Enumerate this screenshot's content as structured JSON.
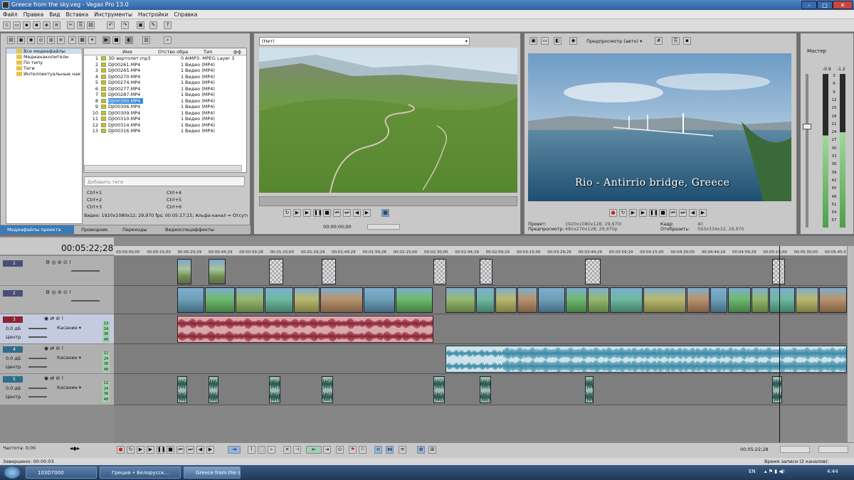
{
  "window": {
    "title": "Greece from the sky.veg - Vegas Pro 13.0"
  },
  "menu": [
    "Файл",
    "Правка",
    "Вид",
    "Вставка",
    "Инструменты",
    "Настройки",
    "Справка"
  ],
  "media_tree": {
    "items": [
      "Все медиафайлы",
      "Медианакопители",
      "По типу",
      "Теги",
      "Интеллектуальные нак"
    ]
  },
  "media_list": {
    "headers": [
      "Имя",
      "Отство обра",
      "Тип",
      "фф"
    ],
    "rows": [
      {
        "num": "1",
        "name": "3D вертолет.mp3",
        "count": "0",
        "type": "AIMP3: MPEG Layer 3"
      },
      {
        "num": "2",
        "name": "DJI00261.MP4",
        "count": "1",
        "type": "Видео (MP4)"
      },
      {
        "num": "3",
        "name": "DJI00265.MP4",
        "count": "1",
        "type": "Видео (MP4)"
      },
      {
        "num": "4",
        "name": "DJI00270.MP4",
        "count": "1",
        "type": "Видео (MP4)"
      },
      {
        "num": "5",
        "name": "DJI00274.MP4",
        "count": "1",
        "type": "Видео (MP4)"
      },
      {
        "num": "6",
        "name": "DJI00277.MP4",
        "count": "1",
        "type": "Видео (MP4)"
      },
      {
        "num": "7",
        "name": "DJI00287.MP4",
        "count": "1",
        "type": "Видео (MP4)"
      },
      {
        "num": "8",
        "name": "DJI00300.MP4",
        "count": "1",
        "type": "Видео (MP4)"
      },
      {
        "num": "9",
        "name": "DJI00306.MP4",
        "count": "1",
        "type": "Видео (MP4)"
      },
      {
        "num": "10",
        "name": "DJI00309.MP4",
        "count": "1",
        "type": "Видео (MP4)"
      },
      {
        "num": "11",
        "name": "DJI00310.MP4",
        "count": "1",
        "type": "Видео (MP4)"
      },
      {
        "num": "12",
        "name": "DJI00314.MP4",
        "count": "1",
        "type": "Видео (MP4)"
      },
      {
        "num": "13",
        "name": "DJI00316.MP4",
        "count": "1",
        "type": "Видео (MP4)"
      }
    ],
    "selected": "DJI00300.MP4"
  },
  "tags": {
    "placeholder": "Добавить теги",
    "shortcuts": [
      "Ctrl+1",
      "Ctrl+4",
      "Ctrl+2",
      "Ctrl+5",
      "Ctrl+3",
      "Ctrl+6"
    ]
  },
  "media_info": "Видео: 1920x1080x12; 29,970 fps; 00:05:17;15; Альфа-канал = Отсутст",
  "tabs": [
    "Медиафайлы проекта",
    "Проводник",
    "Переходы",
    "Видеоспецэффекты"
  ],
  "trimmer": {
    "dropdown": "(Нет)",
    "timecode": "00:00:00;00"
  },
  "preview": {
    "mode": "Предпросмотр (авто)",
    "overlay_text": "Rio - Antirrio bridge, Greece",
    "project_label": "Проект:",
    "project_value": "1920x1080x128; 29,970i",
    "preview_label": "Предпросмотр:",
    "preview_value": "480x270x128; 29,970p",
    "frame_label": "Кадр:",
    "frame_value": "40",
    "display_label": "Отобразить:",
    "display_value": "593x334x32; 29,970"
  },
  "master": {
    "label": "Мастер",
    "left_value": "-0.9",
    "right_value": "-1.2",
    "scale": [
      "3",
      "6",
      "9",
      "12",
      "15",
      "18",
      "21",
      "24",
      "27",
      "30",
      "33",
      "36",
      "39",
      "42",
      "45",
      "48",
      "51",
      "54",
      "57"
    ]
  },
  "timeline": {
    "timecode": "00:05:22;28",
    "ruler": [
      "00:00:00;00",
      "00:00:15;00",
      "00:00:29;29",
      "00:00:44;29",
      "00:00:59;28",
      "00:01:15;00",
      "00:01:29;29",
      "00:01:44;29",
      "00:01:59;28",
      "00:02:15;00",
      "00:02:30;00",
      "00:02:44;29",
      "00:02:59;29",
      "00:03:15;00",
      "00:03:29;29",
      "00:03:44;29",
      "00:03:59;29",
      "00:04:15;00",
      "00:04:30;00",
      "00:04:44;29",
      "00:04:59;29",
      "00:05:15;00",
      "00:05:30;00",
      "00:05:45;0"
    ],
    "tracks": [
      {
        "num": "1",
        "type": "video"
      },
      {
        "num": "2",
        "type": "video"
      },
      {
        "num": "3",
        "type": "audio",
        "volume": "0,0 дБ",
        "pan": "Центр",
        "mode": "Касание"
      },
      {
        "num": "4",
        "type": "audio",
        "volume": "0,0 дБ",
        "pan": "Центр",
        "mode": "Касание"
      },
      {
        "num": "5",
        "type": "audio",
        "volume": "0,0 дБ",
        "pan": "Центр",
        "mode": "Касание"
      }
    ],
    "meter_ticks": [
      "12",
      "24",
      "36",
      "48"
    ]
  },
  "bottom": {
    "rate_label": "Частота: 0,00",
    "timecode": "00:05:22;28",
    "status_left": "Завершено: 00:00:03",
    "status_right": "Время записи (2 каналов): 121:41:10"
  },
  "taskbar": {
    "items": [
      "103D7000",
      "Греция • Белорусск...",
      "Greece from the sky...."
    ],
    "lang": "EN",
    "time": "4:44"
  }
}
